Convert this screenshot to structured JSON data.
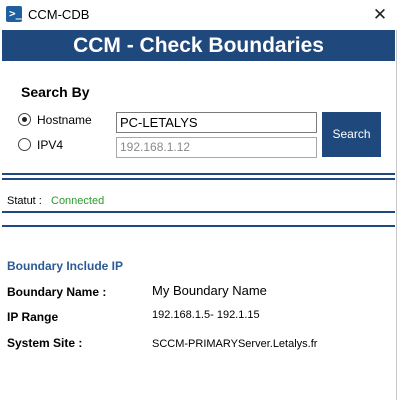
{
  "window": {
    "app_title": "CCM-CDB",
    "close_glyph": "✕"
  },
  "banner": {
    "title": "CCM - Check Boundaries"
  },
  "search": {
    "section_label": "Search By",
    "options": [
      {
        "label": "Hostname",
        "selected": true
      },
      {
        "label": "IPV4",
        "selected": false
      }
    ],
    "hostname_value": "PC-LETALYS",
    "ipv4_placeholder": "192.168.1.12",
    "button_label": "Search"
  },
  "status": {
    "label": "Statut :",
    "value": "Connected",
    "value_color": "#2a9a2a"
  },
  "boundary": {
    "section_title": "Boundary Include IP",
    "rows": [
      {
        "label": "Boundary Name :",
        "value": "My Boundary Name"
      },
      {
        "label": "IP Range",
        "value": "192.168.1.5- 192.1.15"
      },
      {
        "label": "System Site :",
        "value": "SCCM-PRIMARYServer.Letalys.fr"
      }
    ]
  },
  "colors": {
    "accent": "#1f487c",
    "section_title": "#2b5a94"
  },
  "icons": {
    "app": "powershell-icon",
    "close": "close-icon"
  }
}
